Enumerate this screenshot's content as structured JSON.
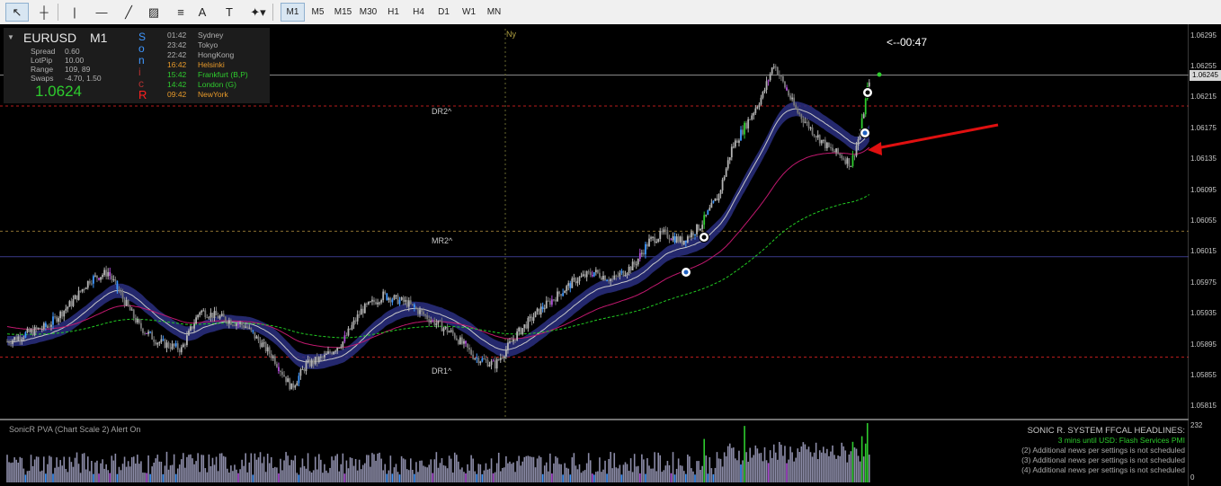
{
  "toolbar": {
    "tools": [
      {
        "name": "cursor-tool",
        "glyph": "↖"
      },
      {
        "name": "crosshair-tool",
        "glyph": "┼"
      },
      {
        "name": "vertical-line-tool",
        "glyph": "|"
      },
      {
        "name": "horizontal-line-tool",
        "glyph": "—"
      },
      {
        "name": "trendline-tool",
        "glyph": "╱"
      },
      {
        "name": "channel-tool",
        "glyph": "▨"
      },
      {
        "name": "fibonacci-tool",
        "glyph": "≡"
      },
      {
        "name": "text-tool",
        "glyph": "A"
      },
      {
        "name": "text-label-tool",
        "glyph": "T"
      },
      {
        "name": "shapes-tool",
        "glyph": "✦▾"
      }
    ],
    "timeframes": [
      "M1",
      "M5",
      "M15",
      "M30",
      "H1",
      "H4",
      "D1",
      "W1",
      "MN"
    ]
  },
  "info": {
    "symbol": "EURUSD",
    "timeframe": "M1",
    "spread_label": "Spread",
    "spread": "0.60",
    "lotpip_label": "LotPip",
    "lotpip": "10.00",
    "range_label": "Range",
    "range": "109, 89",
    "swaps_label": "Swaps",
    "swaps": "-4.70, 1.50",
    "price": "1.0624"
  },
  "sonic_letters": [
    {
      "ch": "S",
      "color": "#3f97ff"
    },
    {
      "ch": "o",
      "color": "#3f97ff"
    },
    {
      "ch": "n",
      "color": "#3f97ff"
    },
    {
      "ch": "i",
      "color": "#b03030"
    },
    {
      "ch": "c",
      "color": "#b03030"
    },
    {
      "ch": "R",
      "color": "#ff2020"
    }
  ],
  "sessions": [
    {
      "time": "01:42",
      "name": "Sydney",
      "color": "#b0b0b0"
    },
    {
      "time": "23:42",
      "name": "Tokyo",
      "color": "#b0b0b0"
    },
    {
      "time": "22:42",
      "name": "HongKong",
      "color": "#b0b0b0"
    },
    {
      "time": "16:42",
      "name": "Helsinki",
      "color": "#e89a2a"
    },
    {
      "time": "15:42",
      "name": "Frankfurt  (B,P)",
      "color": "#2ecc2e"
    },
    {
      "time": "14:42",
      "name": "London  (G)",
      "color": "#2ecc2e"
    },
    {
      "time": "09:42",
      "name": "NewYork",
      "color": "#e89a2a"
    }
  ],
  "chart_labels": {
    "ny": "Ny",
    "timer": "<--00:47",
    "dr2": "DR2^",
    "mr2": "MR2^",
    "dr1": "DR1^",
    "indicator": "SonicR PVA  (Chart Scale 2)   Alert On"
  },
  "colors": {
    "bull": "#b4b4b4",
    "bear": "#777777",
    "bull_climax": "#2ecc2e",
    "bear_climax": "#e02020",
    "rising": "#3f97ff",
    "churn": "#b04dd8",
    "normal_vol": "#8c8ca8",
    "dragon": "#2a2f80",
    "ema34": "#c8c8c8",
    "ema89": "#c0186e",
    "ema200": "#22cc22"
  },
  "axis": {
    "labels": [
      "1.06295",
      "1.06255",
      "1.06215",
      "1.06175",
      "1.06135",
      "1.06095",
      "1.06055",
      "1.06015",
      "1.05975",
      "1.05935",
      "1.05895",
      "1.05855",
      "1.05815"
    ],
    "current": "1.06245",
    "vol_top": "232",
    "vol_bottom": "0"
  },
  "headlines": {
    "title": "SONIC R. SYSTEM  FFCAL HEADLINES:",
    "alert": "3 mins until USD: Flash Services PMI",
    "items": [
      "(2)  Additional news per settings is not scheduled",
      "(3)  Additional news per settings is not scheduled",
      "(4)  Additional news per settings is not scheduled"
    ]
  },
  "chart_data": {
    "type": "candlestick",
    "symbol": "EURUSD",
    "timeframe": "M1",
    "y_range": [
      1.05805,
      1.06305
    ],
    "current_price": 1.06245,
    "levels": {
      "DR2": 1.06205,
      "MR2": 1.06043,
      "DR1": 1.0588
    },
    "anchors": [
      [
        0,
        1.059
      ],
      [
        10,
        1.0591
      ],
      [
        22,
        1.0592
      ],
      [
        35,
        1.0595
      ],
      [
        45,
        1.0598
      ],
      [
        55,
        1.0599
      ],
      [
        62,
        1.0596
      ],
      [
        72,
        1.0592
      ],
      [
        82,
        1.059
      ],
      [
        95,
        1.0589
      ],
      [
        105,
        1.0594
      ],
      [
        118,
        1.0593
      ],
      [
        130,
        1.0592
      ],
      [
        145,
        1.0588
      ],
      [
        155,
        1.0584
      ],
      [
        163,
        1.0587
      ],
      [
        173,
        1.0588
      ],
      [
        183,
        1.059
      ],
      [
        193,
        1.0594
      ],
      [
        205,
        1.0596
      ],
      [
        218,
        1.0595
      ],
      [
        230,
        1.0593
      ],
      [
        243,
        1.0591
      ],
      [
        255,
        1.0588
      ],
      [
        266,
        1.0587
      ],
      [
        278,
        1.0591
      ],
      [
        290,
        1.0594
      ],
      [
        300,
        1.0596
      ],
      [
        310,
        1.0598
      ],
      [
        320,
        1.0599
      ],
      [
        330,
        1.0598
      ],
      [
        342,
        1.06
      ],
      [
        350,
        1.0603
      ],
      [
        358,
        1.0604
      ],
      [
        368,
        1.0603
      ],
      [
        378,
        1.0605
      ],
      [
        388,
        1.0609
      ],
      [
        395,
        1.0615
      ],
      [
        405,
        1.0619
      ],
      [
        412,
        1.0622
      ],
      [
        418,
        1.0626
      ],
      [
        424,
        1.0623
      ],
      [
        430,
        1.062
      ],
      [
        440,
        1.0617
      ],
      [
        448,
        1.0615
      ],
      [
        455,
        1.0614
      ],
      [
        460,
        1.0613
      ],
      [
        465,
        1.0617
      ],
      [
        470,
        1.0624
      ]
    ],
    "volume": {
      "max": 232
    }
  }
}
